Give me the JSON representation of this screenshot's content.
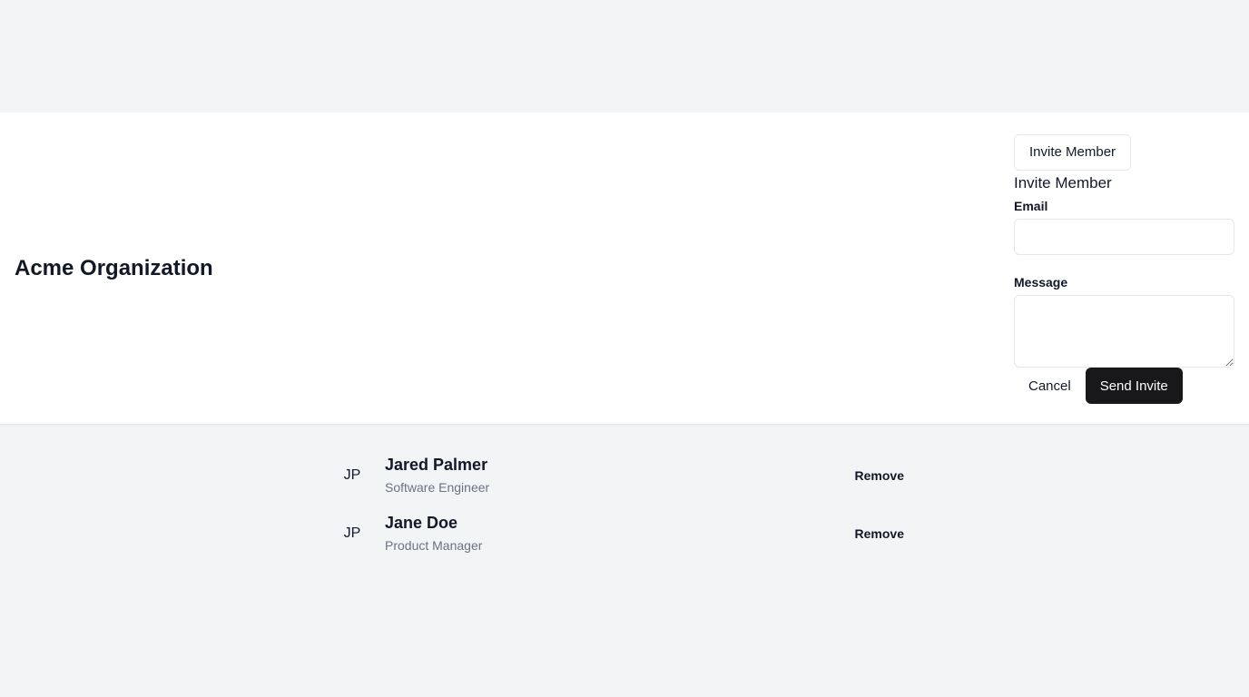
{
  "organization": {
    "title": "Acme Organization"
  },
  "invite": {
    "trigger_label": "Invite Member",
    "heading": "Invite Member",
    "email_label": "Email",
    "email_value": "",
    "message_label": "Message",
    "message_value": "",
    "cancel_label": "Cancel",
    "send_label": "Send Invite"
  },
  "members": [
    {
      "initials": "JP",
      "name": "Jared Palmer",
      "role": "Software Engineer",
      "remove_label": "Remove"
    },
    {
      "initials": "JP",
      "name": "Jane Doe",
      "role": "Product Manager",
      "remove_label": "Remove"
    }
  ],
  "colors": {
    "page_background": "#f3f4f6",
    "panel_background": "#ffffff",
    "primary_button": "#18181b",
    "muted_text": "#6b7280"
  }
}
